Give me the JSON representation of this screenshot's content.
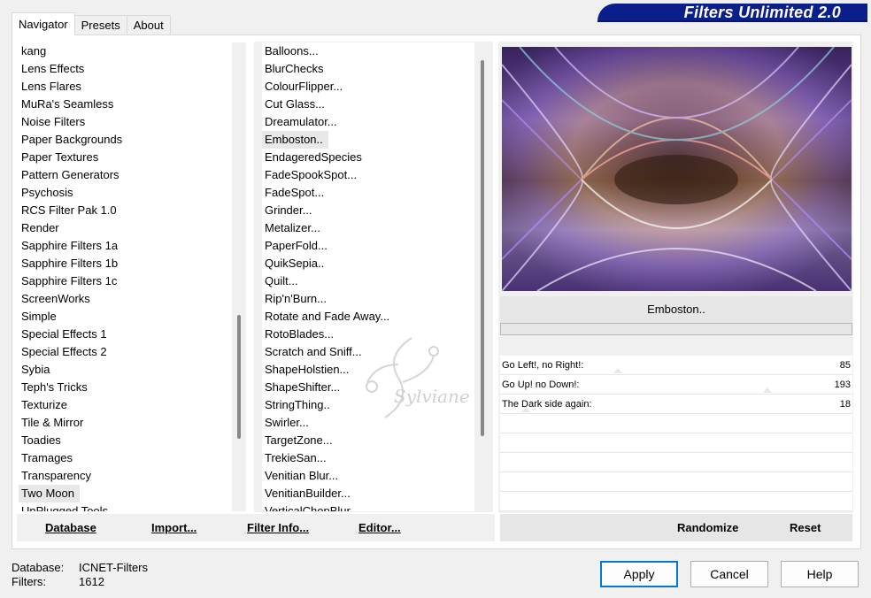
{
  "tabs": [
    {
      "label": "Navigator",
      "active": true
    },
    {
      "label": "Presets",
      "active": false
    },
    {
      "label": "About",
      "active": false
    }
  ],
  "banner": {
    "text": "Filters Unlimited 2.0"
  },
  "categories": {
    "items": [
      "kang",
      "Lens Effects",
      "Lens Flares",
      "MuRa's Seamless",
      "Noise Filters",
      "Paper Backgrounds",
      "Paper Textures",
      "Pattern Generators",
      "Psychosis",
      "RCS Filter Pak 1.0",
      "Render",
      "Sapphire Filters 1a",
      "Sapphire Filters 1b",
      "Sapphire Filters 1c",
      "ScreenWorks",
      "Simple",
      "Special Effects 1",
      "Special Effects 2",
      "Sybia",
      "Teph's Tricks",
      "Texturize",
      "Tile & Mirror",
      "Toadies",
      "Tramages",
      "Transparency",
      "Two Moon",
      "UnPlugged Tools"
    ],
    "selected": "Two Moon"
  },
  "filters": {
    "items": [
      "Balloons...",
      "BlurChecks",
      "ColourFlipper...",
      "Cut Glass...",
      "Dreamulator...",
      "Emboston..",
      "EndageredSpecies",
      "FadeSpookSpot...",
      "FadeSpot...",
      "Grinder...",
      "Metalizer...",
      "PaperFold...",
      "QuikSepia..",
      "Quilt...",
      "Rip'n'Burn...",
      "Rotate and Fade Away...",
      "RotoBlades...",
      "Scratch and Sniff...",
      "ShapeHolstien...",
      "ShapeShifter...",
      "StringThing..",
      "Swirler...",
      "TargetZone...",
      "TrekieSan...",
      "Venitian Blur...",
      "VenitianBuilder...",
      "VerticalChopBlur..."
    ],
    "selected": "Emboston.."
  },
  "left_buttons": {
    "database": "Database",
    "import": "Import...",
    "filter_info": "Filter Info...",
    "editor": "Editor..."
  },
  "preview": {
    "filter_name": "Emboston.."
  },
  "params": [
    {
      "label": "Go Left!, no Right!:",
      "value": "85",
      "max": 255
    },
    {
      "label": "Go Up! no Down!:",
      "value": "193",
      "max": 255
    },
    {
      "label": "The Dark side again:",
      "value": "18",
      "max": 255
    }
  ],
  "right_buttons": {
    "randomize": "Randomize",
    "reset": "Reset"
  },
  "status": {
    "database_label": "Database:",
    "database_value": "ICNET-Filters",
    "filters_label": "Filters:",
    "filters_value": "1612"
  },
  "dialog_buttons": {
    "apply": "Apply",
    "cancel": "Cancel",
    "help": "Help"
  },
  "watermark_text": "Sylviane",
  "colors": {
    "banner": "#0b1f8a",
    "focus": "#0078d7"
  }
}
